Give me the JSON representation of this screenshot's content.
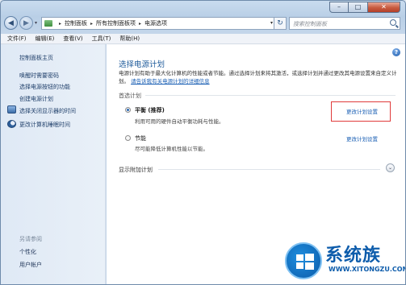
{
  "window": {
    "caption": {
      "minimize": "–",
      "maximize": "□",
      "close": "✕"
    }
  },
  "address_bar": {
    "crumbs": [
      "控制面板",
      "所有控制面板项",
      "电源选项"
    ],
    "search_placeholder": "搜索控制面板",
    "icons": [
      "back-arrow-icon",
      "forward-arrow-icon",
      "refresh-icon",
      "search-icon"
    ]
  },
  "menu": [
    "文件(F)",
    "编辑(E)",
    "查看(V)",
    "工具(T)",
    "帮助(H)"
  ],
  "sidebar": {
    "home": "控制面板主页",
    "links": [
      "唤醒时需要密码",
      "选择电源按钮的功能",
      "创建电源计划"
    ],
    "icon_links": [
      {
        "label": "选择关闭显示器的时间",
        "icon": "monitor-icon"
      },
      {
        "label": "更改计算机睡眠时间",
        "icon": "moon-icon"
      }
    ],
    "see_also_heading": "另请参阅",
    "see_also": [
      "个性化",
      "用户帐户"
    ]
  },
  "main": {
    "title": "选择电源计划",
    "description": "电源计划有助于最大化计算机的性能或者节能。通过选择计划来将其激活，或选择计划并通过更改其电源设置来自定义计划。",
    "description_link": "请告诉我有关电源计划的详细信息",
    "preferred_heading": "首选计划",
    "plans": [
      {
        "name": "平衡 (推荐)",
        "desc": "利用可用的硬件自动平衡功耗与性能。",
        "link": "更改计划设置",
        "selected": true
      },
      {
        "name": "节能",
        "desc": "尽可能降低计算机性能以节能。",
        "link": "更改计划设置",
        "selected": false
      }
    ],
    "show_more": "显示附加计划"
  },
  "watermark": {
    "text": "系统族",
    "url": "WWW.XITONGZU.COM"
  },
  "colors": {
    "title": "#1d5a9a",
    "link": "#1a5fb4",
    "highlight": "#e03a3a"
  }
}
